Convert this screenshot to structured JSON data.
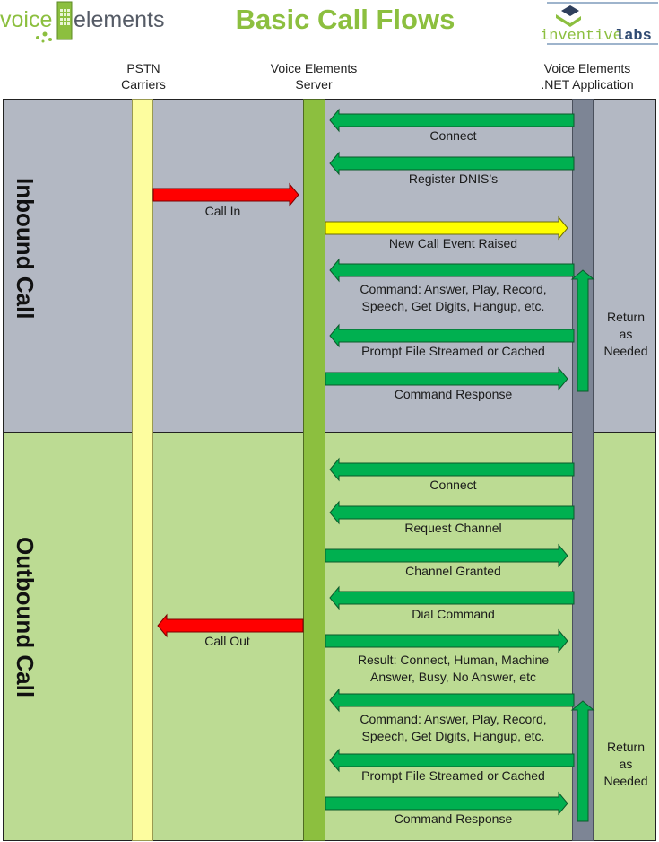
{
  "header": {
    "title": "Basic Call Flows",
    "logo_left": {
      "part1": "voice",
      "part2": "elements"
    },
    "logo_right": {
      "part1": "inventive",
      "part2": "labs"
    }
  },
  "columns": {
    "pstn": "PSTN\nCarriers",
    "server": "Voice Elements\nServer",
    "app": "Voice Elements\n.NET Application"
  },
  "sections": {
    "inbound": {
      "label": "Inbound Call",
      "return_label": "Return\nas\nNeeded",
      "messages": [
        {
          "text": "Connect",
          "direction": "left",
          "color": "green",
          "from": "app",
          "to": "server"
        },
        {
          "text": "Register DNIS’s",
          "direction": "left",
          "color": "green",
          "from": "app",
          "to": "server"
        },
        {
          "text": "Call In",
          "direction": "right",
          "color": "red",
          "from": "pstn",
          "to": "server"
        },
        {
          "text": "New Call Event Raised",
          "direction": "right",
          "color": "yellow",
          "from": "server",
          "to": "app"
        },
        {
          "text": "Command: Answer, Play, Record,\nSpeech, Get Digits, Hangup, etc.",
          "direction": "left",
          "color": "green",
          "from": "app",
          "to": "server"
        },
        {
          "text": "Prompt File Streamed or Cached",
          "direction": "left",
          "color": "green",
          "from": "app",
          "to": "server"
        },
        {
          "text": "Command Response",
          "direction": "right",
          "color": "green",
          "from": "server",
          "to": "app"
        }
      ]
    },
    "outbound": {
      "label": "Outbound Call",
      "return_label": "Return\nas\nNeeded",
      "messages": [
        {
          "text": "Connect",
          "direction": "left",
          "color": "green",
          "from": "app",
          "to": "server"
        },
        {
          "text": "Request Channel",
          "direction": "left",
          "color": "green",
          "from": "app",
          "to": "server"
        },
        {
          "text": "Channel Granted",
          "direction": "right",
          "color": "green",
          "from": "server",
          "to": "app"
        },
        {
          "text": "Dial Command",
          "direction": "left",
          "color": "green",
          "from": "app",
          "to": "server"
        },
        {
          "text": "Call Out",
          "direction": "left",
          "color": "red",
          "from": "server",
          "to": "pstn"
        },
        {
          "text": "Result: Connect, Human, Machine\nAnswer, Busy, No Answer, etc",
          "direction": "right",
          "color": "green",
          "from": "server",
          "to": "app"
        },
        {
          "text": "Command: Answer, Play, Record,\nSpeech, Get Digits, Hangup, etc.",
          "direction": "left",
          "color": "green",
          "from": "app",
          "to": "server"
        },
        {
          "text": "Prompt File Streamed or Cached",
          "direction": "left",
          "color": "green",
          "from": "app",
          "to": "server"
        },
        {
          "text": "Command Response",
          "direction": "right",
          "color": "green",
          "from": "server",
          "to": "app"
        }
      ]
    }
  },
  "colors": {
    "green": "#00b050",
    "red": "#ff0000",
    "yellow": "#ffff00",
    "title": "#8cbf3f",
    "inbound_bg": "#b3b8c3",
    "outbound_bg": "#bcdb93"
  }
}
